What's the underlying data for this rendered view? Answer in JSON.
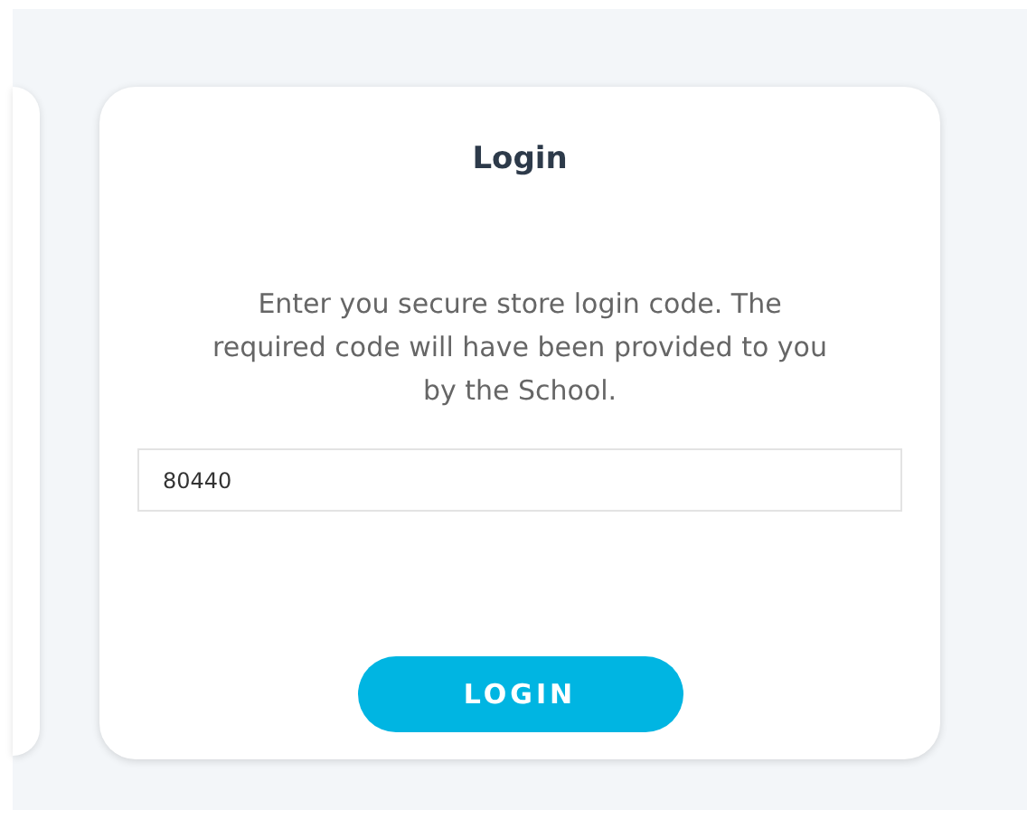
{
  "login_card": {
    "title": "Login",
    "instructions": "Enter you secure store login code. The required code will have been provided to you by the School.",
    "code_field": {
      "value": "80440"
    },
    "button": "LOGIN"
  }
}
